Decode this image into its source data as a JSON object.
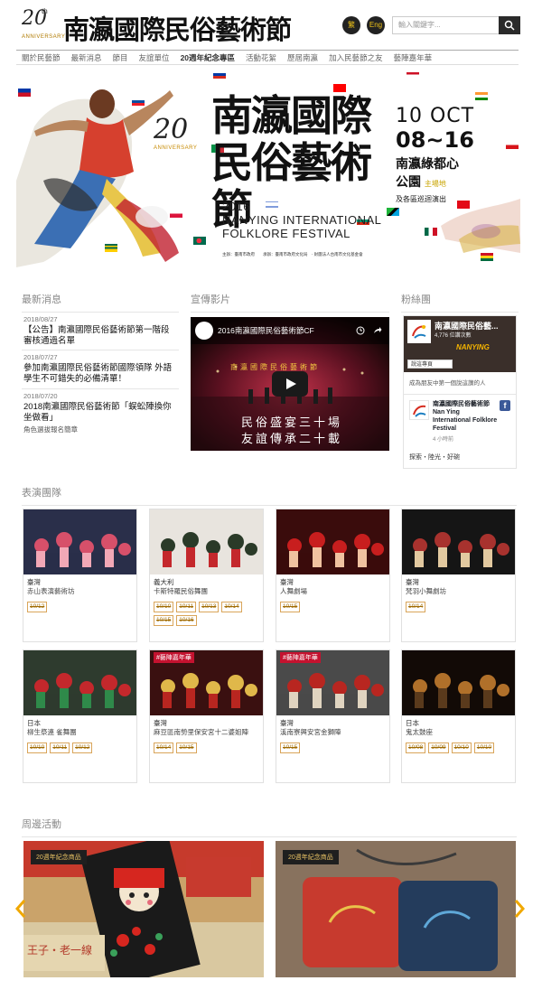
{
  "header": {
    "logo_number": "20",
    "logo_th": "th",
    "logo_anniversary": "ANNIVERSARY",
    "logo_title": "南瀛國際民俗藝術節",
    "lang_zh": "繁",
    "lang_en": "Eng",
    "search_placeholder": "輸入關鍵字..."
  },
  "nav": {
    "items": [
      {
        "label": "關於民藝節"
      },
      {
        "label": "最新消息"
      },
      {
        "label": "節目"
      },
      {
        "label": "友誼單位"
      },
      {
        "label": "20週年紀念專區"
      },
      {
        "label": "活動花絮"
      },
      {
        "label": "歷屆南瀛"
      },
      {
        "label": "加入民藝節之友"
      },
      {
        "label": "藝陣嘉年華"
      }
    ]
  },
  "hero": {
    "anniv_number": "20",
    "anniv_label": "ANNIVERSARY",
    "title": "南瀛國際民俗藝術節",
    "year": "2016",
    "english_line1": "NANYING INTERNATIONAL",
    "english_line2": "FOLKLORE FESTIVAL",
    "date_start": "10 OCT",
    "date_range": "08~16",
    "venue_line1": "南瀛綠都心",
    "venue_line2": "公園",
    "venue_tag": "主場地",
    "tour": "及各區巡迴演出",
    "organizer": "主辦：臺南市政府　　承辦：臺南市政府文化局　‧ 財團法人台南市文化基金會"
  },
  "news": {
    "heading": "最新消息",
    "items": [
      {
        "date": "2018/08/27",
        "text": "【公告】南瀛國際民俗藝術節第一階段審核通過名單",
        "sub": ""
      },
      {
        "date": "2018/07/27",
        "text": "參加南瀛國際民俗藝術節國際領隊 外語學生不可錯失的必備清單！",
        "sub": ""
      },
      {
        "date": "2018/07/20",
        "text": "2018南瀛國際民俗藝術節「蜈蚣陣換你坐做看」",
        "sub": "角色選拔報名簡章"
      }
    ]
  },
  "video": {
    "heading": "宣傳影片",
    "name": "2016南瀛國際民俗藝術節CF",
    "banner": "南瀛國際民俗藝術節",
    "line1": "民俗盛宴三十場",
    "line2": "友誼傳承二十載"
  },
  "fans": {
    "heading": "粉絲團",
    "page_name": "南瀛國際民俗藝...",
    "likes": "4,776 位讚次數",
    "cover_tag": "NANYING",
    "like_btn": "說這專頁",
    "first_friend": "成為朋友中第一個說這讚的人",
    "post_name": "南瀛國際民俗藝術節 Nan Ying International Folklore Festival",
    "post_time": "4 小時前",
    "post_text": "探索・陸光・好碗",
    "fb_letter": "f"
  },
  "troupes": {
    "heading": "表演團隊",
    "items": [
      {
        "country": "臺灣",
        "name": "赤山表演藝術坊",
        "dates": [
          "10/12"
        ],
        "badge": ""
      },
      {
        "country": "義大利",
        "name": "卡斯特羅民俗舞團",
        "dates": [
          "10/10",
          "10/11",
          "10/13",
          "10/14",
          "10/15",
          "10/16"
        ],
        "badge": ""
      },
      {
        "country": "臺灣",
        "name": "人舞劇場",
        "dates": [
          "10/15"
        ],
        "badge": ""
      },
      {
        "country": "臺灣",
        "name": "梵羽小舞劇坊",
        "dates": [
          "10/14"
        ],
        "badge": ""
      },
      {
        "country": "日本",
        "name": "柳生祭連 雀舞團",
        "dates": [
          "10/10",
          "10/11",
          "10/12"
        ],
        "badge": ""
      },
      {
        "country": "臺灣",
        "name": "麻豆區南勢里保安宮十二婆姐陣",
        "dates": [
          "10/14",
          "10/15"
        ],
        "badge": "#藝陣嘉年華"
      },
      {
        "country": "臺灣",
        "name": "溪南寮興安宮金獅陣",
        "dates": [
          "10/15"
        ],
        "badge": "#藝陣嘉年華"
      },
      {
        "country": "日本",
        "name": "鬼太鼓座",
        "dates": [
          "10/08",
          "10/09",
          "10/10",
          "10/10"
        ],
        "badge": ""
      }
    ]
  },
  "events": {
    "heading": "周邊活動",
    "items": [
      {
        "badge": "20週年紀念商品",
        "side_text": "王子‧老一線"
      },
      {
        "badge": "20週年紀念商品",
        "side_text": ""
      }
    ]
  },
  "colors": {
    "accent_gold": "#c9a400",
    "dark": "#222222",
    "date_tag": "#a06a00",
    "arrow": "#f0a800"
  }
}
